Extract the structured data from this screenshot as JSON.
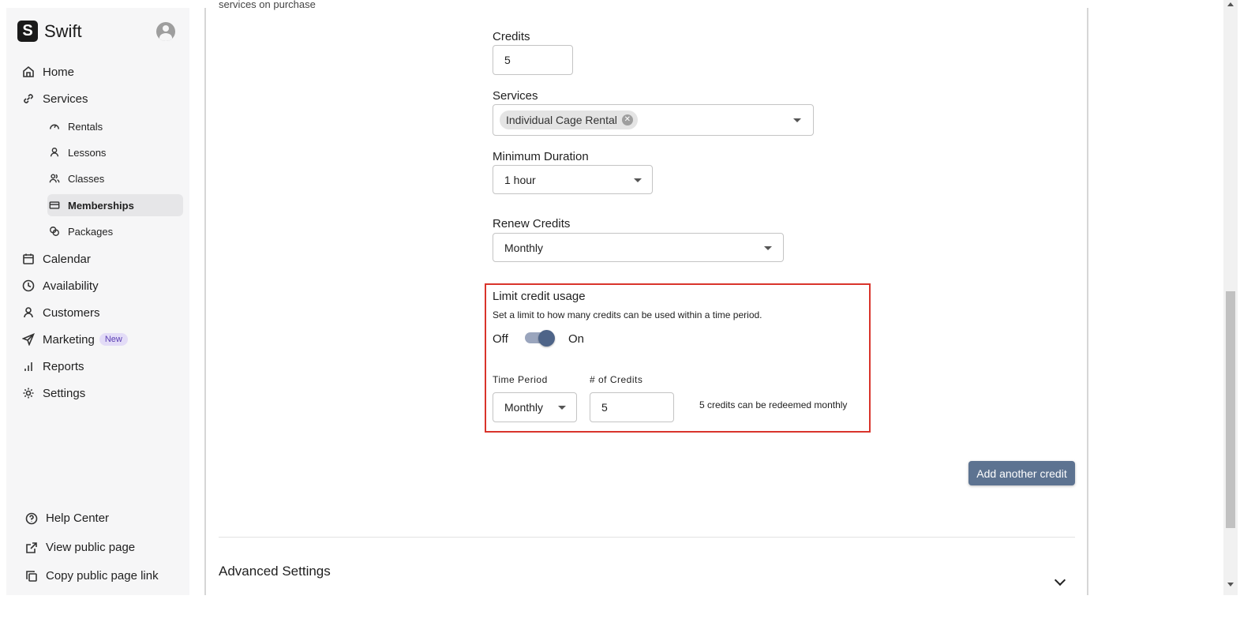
{
  "brand": {
    "name": "Swift",
    "logo_letter": "S"
  },
  "sidebar": {
    "items": [
      {
        "label": "Home",
        "icon": "home-icon"
      },
      {
        "label": "Services",
        "icon": "link-icon"
      },
      {
        "label": "Calendar",
        "icon": "calendar-icon"
      },
      {
        "label": "Availability",
        "icon": "clock-icon"
      },
      {
        "label": "Customers",
        "icon": "user-icon"
      },
      {
        "label": "Marketing",
        "icon": "send-icon",
        "badge": "New"
      },
      {
        "label": "Reports",
        "icon": "bar-chart-icon"
      },
      {
        "label": "Settings",
        "icon": "gear-icon"
      }
    ],
    "sub_items": [
      {
        "label": "Rentals",
        "icon": "gauge-icon"
      },
      {
        "label": "Lessons",
        "icon": "person-icon"
      },
      {
        "label": "Classes",
        "icon": "people-icon"
      },
      {
        "label": "Memberships",
        "icon": "card-icon",
        "active": true
      },
      {
        "label": "Packages",
        "icon": "packages-icon"
      }
    ],
    "footer": [
      {
        "label": "Help Center",
        "icon": "help-icon"
      },
      {
        "label": "View public page",
        "icon": "external-link-icon"
      },
      {
        "label": "Copy public page link",
        "icon": "copy-icon"
      }
    ]
  },
  "main": {
    "cut_text": "services on purchase",
    "credits": {
      "label": "Credits",
      "value": "5"
    },
    "services": {
      "label": "Services",
      "chip": "Individual Cage Rental"
    },
    "min_duration": {
      "label": "Minimum Duration",
      "value": "1 hour"
    },
    "renew": {
      "label": "Renew Credits",
      "value": "Monthly"
    },
    "limit": {
      "title": "Limit credit usage",
      "description": "Set a limit to how many credits can be used within a time period.",
      "off_label": "Off",
      "on_label": "On",
      "toggle_on": true,
      "time_period_label": "Time Period",
      "time_period_value": "Monthly",
      "num_credits_label": "# of Credits",
      "num_credits_value": "5",
      "summary": "5 credits can be redeemed monthly"
    },
    "add_button": "Add another credit",
    "advanced": "Advanced Settings"
  },
  "colors": {
    "accent": "#5d7391",
    "highlight_border": "#d9342b",
    "toggle_knob": "#4e6488"
  }
}
